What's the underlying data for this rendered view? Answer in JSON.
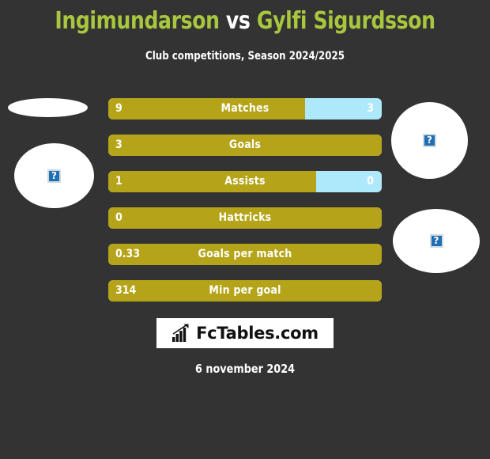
{
  "header": {
    "player_left": "Ingimundarson",
    "vs": "vs",
    "player_right": "Gylfi Sigurdsson",
    "subtitle": "Club competitions, Season 2024/2025"
  },
  "colors": {
    "background": "#333333",
    "title_accent": "#a8c73e",
    "bar_left": "#b5a419",
    "bar_right": "#aee9fb",
    "text": "#ffffff",
    "placeholder_icon": "#1f6fb2"
  },
  "avatars": [
    {
      "name": "left-top-placeholder",
      "side": "left",
      "icon": "broken-image-icon",
      "glyph": "?"
    },
    {
      "name": "left-main-placeholder",
      "side": "left",
      "icon": "broken-image-icon",
      "glyph": "?"
    },
    {
      "name": "right-top-placeholder",
      "side": "right",
      "icon": "broken-image-icon",
      "glyph": "?"
    },
    {
      "name": "right-main-placeholder",
      "side": "right",
      "icon": "broken-image-icon",
      "glyph": "?"
    }
  ],
  "chart_data": {
    "type": "bar",
    "title": "Ingimundarson vs Gylfi Sigurdsson",
    "subtitle": "Club competitions, Season 2024/2025",
    "orientation": "horizontal-diverging",
    "series": [
      {
        "name": "Ingimundarson",
        "color": "#b5a419",
        "values": [
          9,
          3,
          1,
          0,
          0.33,
          314
        ]
      },
      {
        "name": "Gylfi Sigurdsson",
        "color": "#aee9fb",
        "values": [
          3,
          0,
          0,
          0,
          0,
          0
        ]
      }
    ],
    "categories": [
      "Matches",
      "Goals",
      "Assists",
      "Hattricks",
      "Goals per match",
      "Min per goal"
    ],
    "rows": [
      {
        "label": "Matches",
        "left_value": "9",
        "right_value": "3",
        "left_pct": 72,
        "show_right": true
      },
      {
        "label": "Goals",
        "left_value": "3",
        "right_value": "0",
        "left_pct": 100,
        "show_right": false
      },
      {
        "label": "Assists",
        "left_value": "1",
        "right_value": "0",
        "left_pct": 76,
        "show_right": true
      },
      {
        "label": "Hattricks",
        "left_value": "0",
        "right_value": "0",
        "left_pct": 100,
        "show_right": false
      },
      {
        "label": "Goals per match",
        "left_value": "0.33",
        "right_value": "0",
        "left_pct": 100,
        "show_right": false
      },
      {
        "label": "Min per goal",
        "left_value": "314",
        "right_value": "0",
        "left_pct": 100,
        "show_right": false
      }
    ],
    "grid": false,
    "legend": "none"
  },
  "footer": {
    "logo_text": "FcTables.com",
    "logo_icon": "bar-chart-arrow-icon",
    "date": "6 november 2024"
  }
}
